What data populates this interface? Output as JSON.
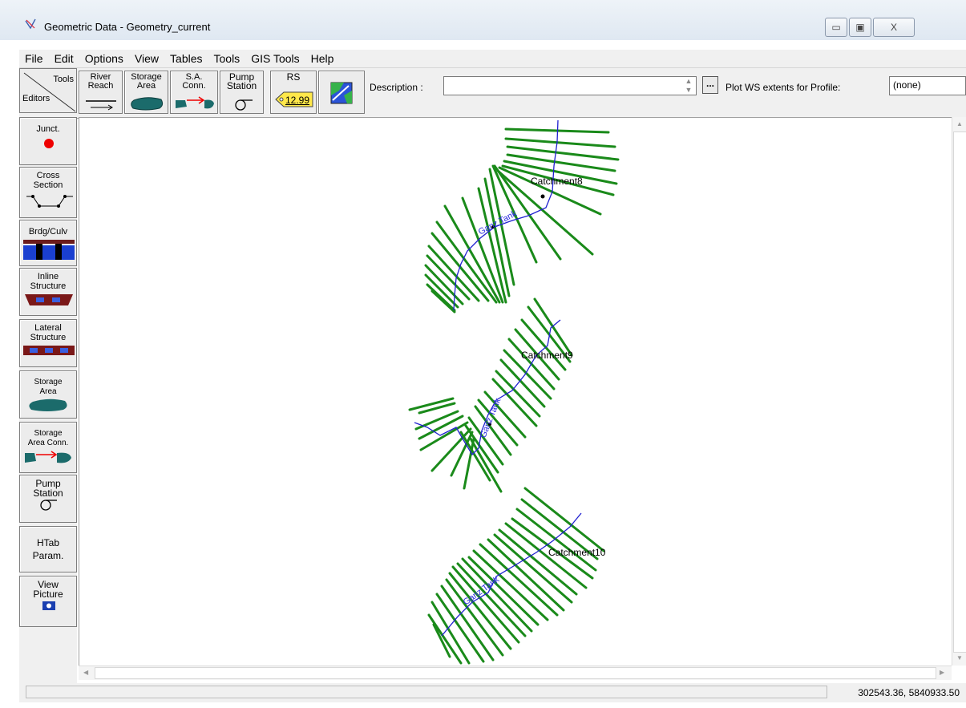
{
  "window": {
    "title": "Geometric Data - Geometry_current",
    "minimize_glyph": "▭",
    "maximize_glyph": "▣",
    "close_glyph": "X"
  },
  "menu": [
    "File",
    "Edit",
    "Options",
    "View",
    "Tables",
    "Tools",
    "GIS Tools",
    "Help"
  ],
  "toolbar": {
    "corner_tools": "Tools",
    "corner_editors": "Editors",
    "river_reach": "River\nReach",
    "storage_area": "Storage\nArea",
    "sa_conn": "S.A.\nConn.",
    "pump_station": "Pump\nStation",
    "rs_label": "RS",
    "rs_value": "12.99",
    "description_label": "Description :",
    "description_value": "",
    "browse_label": "...",
    "plot_ws_label": "Plot WS extents for Profile:",
    "profile_value": "(none)"
  },
  "editors": [
    {
      "id": "junct",
      "label": "Junct."
    },
    {
      "id": "cross-section",
      "label": "Cross\nSection"
    },
    {
      "id": "brdg-culv",
      "label": "Brdg/Culv"
    },
    {
      "id": "inline-structure",
      "label": "Inline\nStructure"
    },
    {
      "id": "lateral-structure",
      "label": "Lateral\nStructure"
    },
    {
      "id": "storage-area",
      "label": "Storage\nArea"
    },
    {
      "id": "storage-area-conn",
      "label": "Storage\nArea Conn."
    },
    {
      "id": "pump-station",
      "label": "Pump\nStation"
    },
    {
      "id": "htab-param",
      "label": "HTab\nParam."
    },
    {
      "id": "view-picture",
      "label": "View\nPicture"
    }
  ],
  "map": {
    "catchments": [
      "Catchment8",
      "Catchment9",
      "Catchment10"
    ],
    "reach_labels": [
      "Ganz Tank",
      "Ganz Tank",
      "Ganz Tank"
    ],
    "colors": {
      "cross_section": "#1a8a1a",
      "river": "#2020d0",
      "junction": "#ee0000"
    }
  },
  "status": {
    "coordinates": "302543.36, 5840933.50"
  }
}
